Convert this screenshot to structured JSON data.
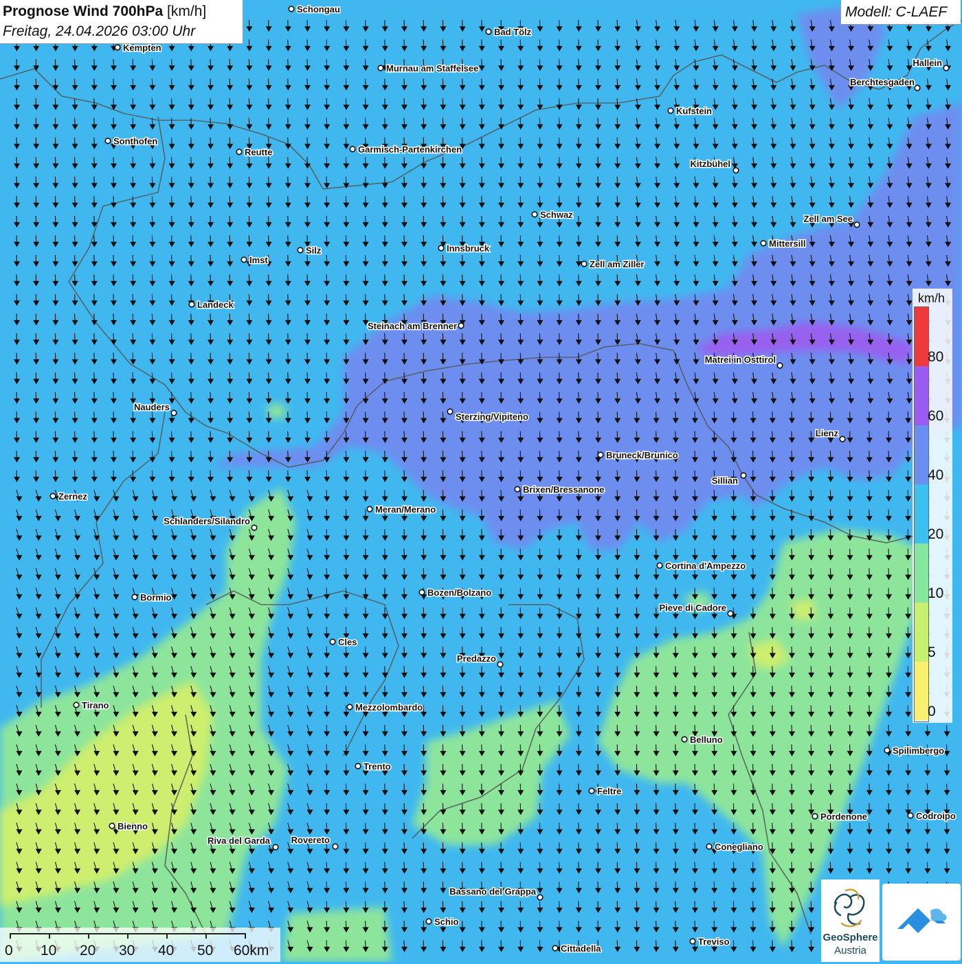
{
  "header": {
    "title_bold": "Prognose Wind 700hPa",
    "title_unit": "[km/h]",
    "datetime": "Freitag, 24.04.2026 03:00 Uhr",
    "model": "Modell: C-LAEF"
  },
  "legend": {
    "unit": "km/h",
    "ticks": [
      "80",
      "60",
      "40",
      "20",
      "10",
      "5",
      "0"
    ],
    "colors": [
      "#ee3a3a",
      "#9a5cf0",
      "#6a8ff0",
      "#3cc0ee",
      "#86e69e",
      "#c8f070",
      "#f8f070"
    ]
  },
  "scalebar": {
    "labels": [
      "0",
      "10",
      "20",
      "30",
      "40",
      "50",
      "60km"
    ]
  },
  "colors": {
    "base_wind": "#40b8ef",
    "strong_wind": "#6f8cf0",
    "very_strong_wind": "#9860ef",
    "calm": "#8de59c",
    "very_calm": "#cdee6e",
    "border": "#555555",
    "arrow": "#111111"
  },
  "cities": [
    {
      "name": "Schongau"
    },
    {
      "name": "Bad Tölz"
    },
    {
      "name": "Kempten"
    },
    {
      "name": "Murnau am Staffelsee"
    },
    {
      "name": "Hallein"
    },
    {
      "name": "Berchtesgaden"
    },
    {
      "name": "Kufstein"
    },
    {
      "name": "Sonthofen"
    },
    {
      "name": "Reutte"
    },
    {
      "name": "Garmisch-Partenkirchen"
    },
    {
      "name": "Kitzbühel"
    },
    {
      "name": "Schwaz"
    },
    {
      "name": "Zell am See"
    },
    {
      "name": "Mittersill"
    },
    {
      "name": "Innsbruck"
    },
    {
      "name": "Silz"
    },
    {
      "name": "Imst"
    },
    {
      "name": "Zell am Ziller"
    },
    {
      "name": "Landeck"
    },
    {
      "name": "Steinach am Brenner"
    },
    {
      "name": "Matrei in Osttirol"
    },
    {
      "name": "Nauders"
    },
    {
      "name": "Sterzing/Vipiteno"
    },
    {
      "name": "Lienz"
    },
    {
      "name": "Bruneck/Brunico"
    },
    {
      "name": "Sillian"
    },
    {
      "name": "Brixen/Bressanone"
    },
    {
      "name": "Zernez"
    },
    {
      "name": "Meran/Merano"
    },
    {
      "name": "Schlanders/Silandro"
    },
    {
      "name": "Cortina d'Ampezzo"
    },
    {
      "name": "Bozen/Bolzano"
    },
    {
      "name": "Bormio"
    },
    {
      "name": "Pieve di Cadore"
    },
    {
      "name": "Cles"
    },
    {
      "name": "Predazzo"
    },
    {
      "name": "Tirano"
    },
    {
      "name": "Mezzolombardo"
    },
    {
      "name": "Belluno"
    },
    {
      "name": "Spilimbergo"
    },
    {
      "name": "Trento"
    },
    {
      "name": "Feltre"
    },
    {
      "name": "Pordenone"
    },
    {
      "name": "Codroipo"
    },
    {
      "name": "Bienno"
    },
    {
      "name": "Riva del Garda"
    },
    {
      "name": "Rovereto"
    },
    {
      "name": "Conegliano"
    },
    {
      "name": "Bassano del Grappa"
    },
    {
      "name": "Schio"
    },
    {
      "name": "Treviso"
    },
    {
      "name": "Cittadella"
    }
  ],
  "logo": {
    "name_line1": "GeoSphere",
    "name_line2": "Austria"
  }
}
